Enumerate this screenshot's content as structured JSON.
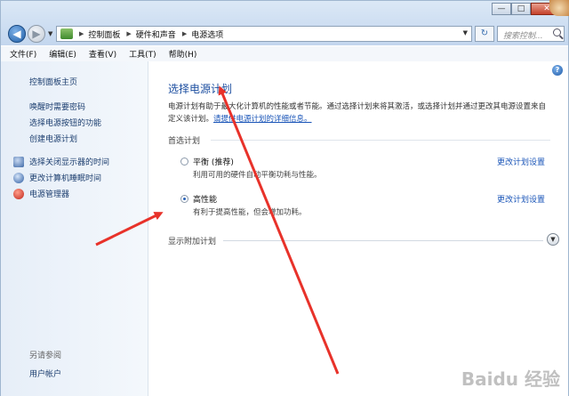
{
  "window": {
    "controls": {
      "minimize": "—",
      "maximize": "□",
      "close": "✕"
    }
  },
  "address": {
    "crumbs": [
      "控制面板",
      "硬件和声音",
      "电源选项"
    ],
    "search_placeholder": "搜索控制..."
  },
  "menu": [
    "文件(F)",
    "编辑(E)",
    "查看(V)",
    "工具(T)",
    "帮助(H)"
  ],
  "sidebar": {
    "home": "控制面板主页",
    "items": [
      "唤醒时需要密码",
      "选择电源按钮的功能",
      "创建电源计划",
      "选择关闭显示器的时间",
      "更改计算机睡眠时间",
      "电源管理器"
    ],
    "see_also": "另请参阅",
    "user_accounts": "用户帐户"
  },
  "main": {
    "title": "选择电源计划",
    "description": "电源计划有助于最大化计算机的性能或者节能。通过选择计划来将其激活，或选择计划并通过更改其电源设置来自定义该计划。",
    "description_link": "请提供电源计划的详细信息。",
    "preferred_label": "首选计划",
    "plans": [
      {
        "name": "平衡 (推荐)",
        "desc": "利用可用的硬件自动平衡功耗与性能。",
        "link": "更改计划设置",
        "selected": false
      },
      {
        "name": "高性能",
        "desc": "有利于提高性能，但会增加功耗。",
        "link": "更改计划设置",
        "selected": true
      }
    ],
    "show_more": "显示附加计划"
  },
  "watermark": "Baidu 经验",
  "colors": {
    "accent": "#1c4ea0",
    "arrow": "#e8322a"
  }
}
